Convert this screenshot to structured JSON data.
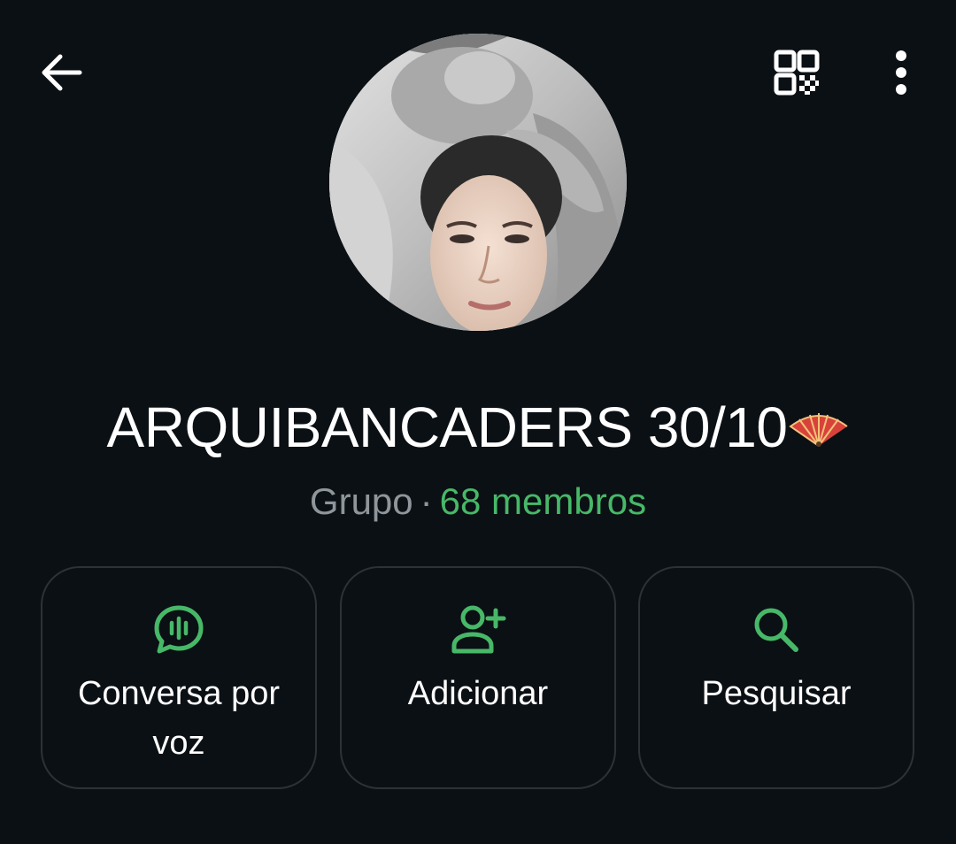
{
  "header": {
    "back_icon": "arrow-left-icon",
    "qr_icon": "qr-code-icon",
    "menu_icon": "more-vertical-icon"
  },
  "group": {
    "name": "ARQUIBANCADERS 30/10",
    "emoji_icon": "folding-fan-emoji",
    "type": "Grupo",
    "separator": "·",
    "members": "68 membros"
  },
  "actions": [
    {
      "label": "Conversa por voz",
      "icon": "voice-chat-icon"
    },
    {
      "label": "Adicionar",
      "icon": "add-person-icon"
    },
    {
      "label": "Pesquisar",
      "icon": "search-icon"
    }
  ],
  "colors": {
    "background": "#0b1014",
    "accent": "#47b868",
    "muted_text": "#8e969c",
    "card_border": "#2c3236"
  }
}
